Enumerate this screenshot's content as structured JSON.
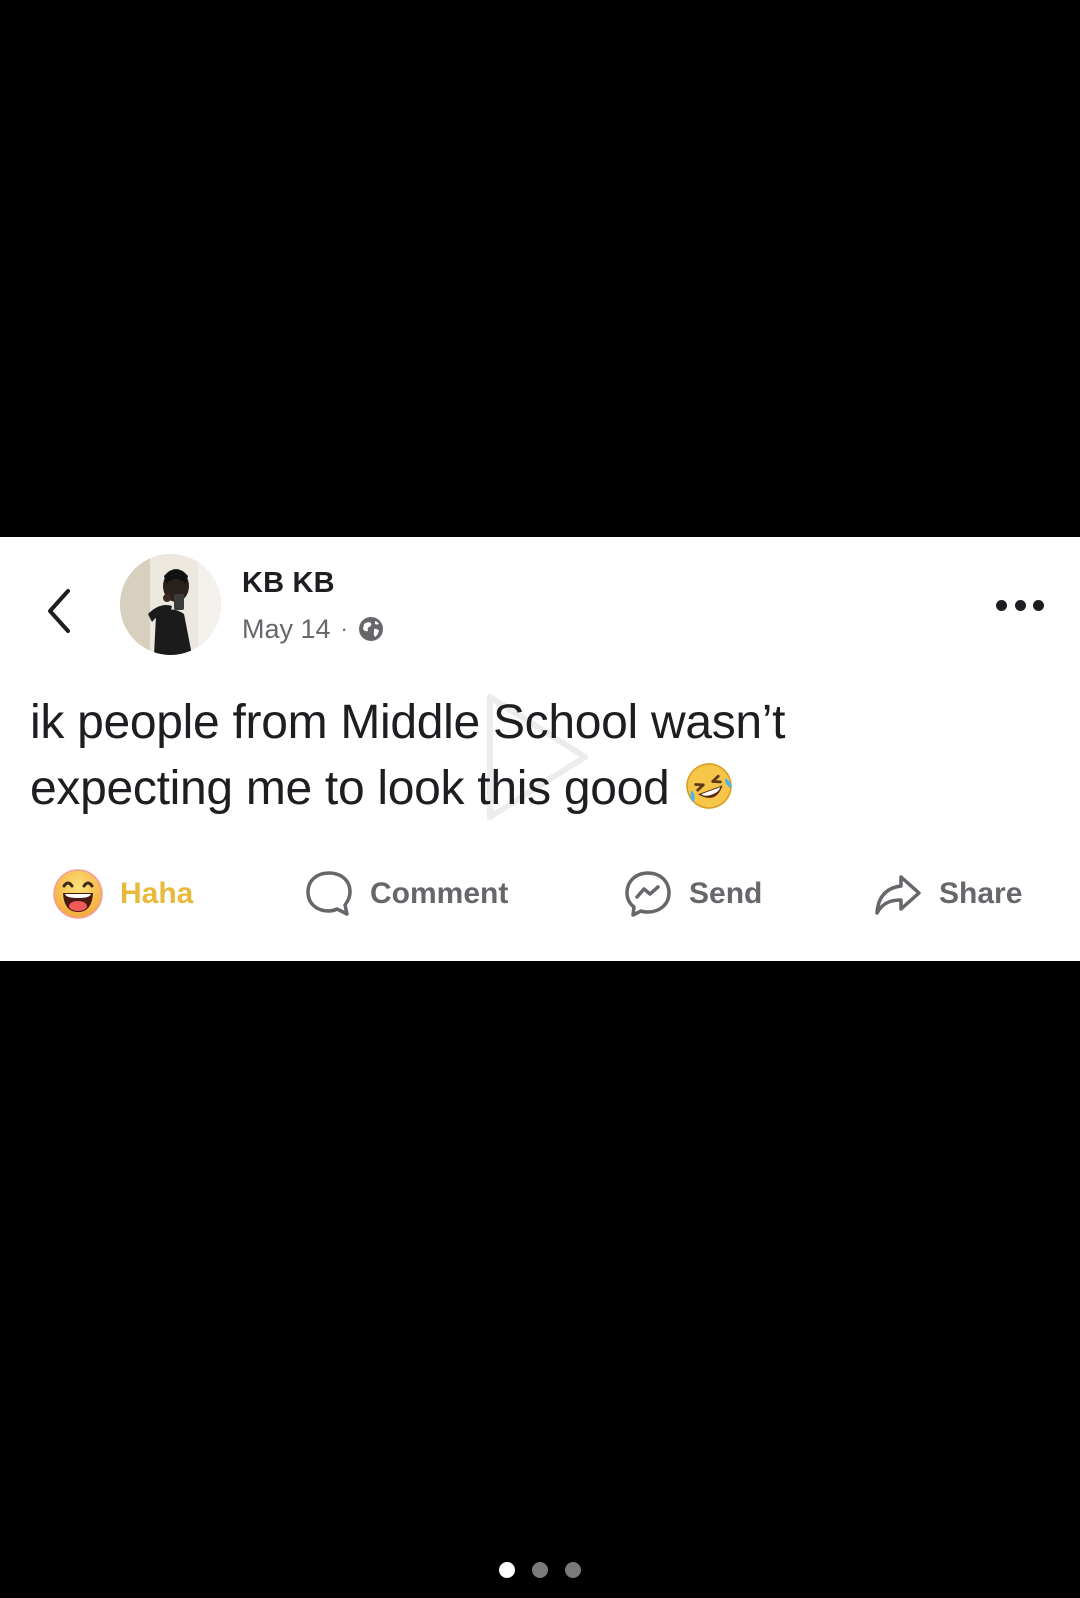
{
  "post": {
    "author_name": "KB KB",
    "date": "May 14",
    "separator": "·",
    "audience_icon": "globe-icon",
    "text_line_1": "ik people from Middle School wasn’t",
    "text_line_2": "expecting me to look this good",
    "trailing_emoji": "rolling-on-floor-laughing-emoji"
  },
  "actions": {
    "reaction_label": "Haha",
    "reaction_icon": "haha-emoji-icon",
    "comment_label": "Comment",
    "comment_icon": "comment-bubble-icon",
    "send_label": "Send",
    "send_icon": "messenger-icon",
    "share_label": "Share",
    "share_icon": "share-arrow-icon"
  },
  "navigation": {
    "back_icon": "chevron-left-icon",
    "more_icon": "more-options-icon"
  },
  "pager": {
    "total_pages": 3,
    "active_page": 1
  },
  "colors": {
    "background": "#000000",
    "card": "#ffffff",
    "text_primary": "#1c1e21",
    "text_secondary": "#65676b",
    "haha_accent": "#e8b93a"
  }
}
